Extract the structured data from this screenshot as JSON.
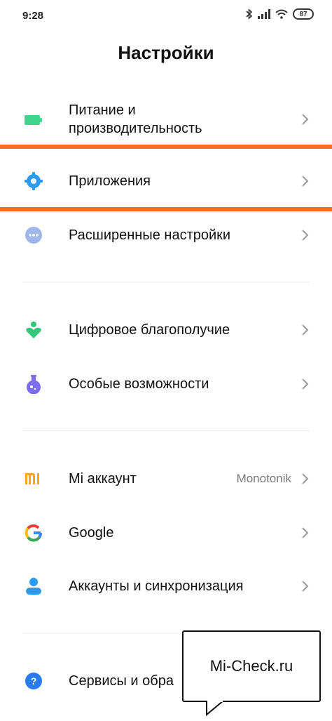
{
  "status_bar": {
    "time": "9:28",
    "battery": "87"
  },
  "header": {
    "title": "Настройки"
  },
  "groups": [
    {
      "items": [
        {
          "label_line1": "Питание и",
          "label_line2": "производительность",
          "icon": "battery-icon",
          "color": "#3dd68c"
        },
        {
          "label": "Приложения",
          "icon": "gear-icon",
          "color": "#2b9af3"
        },
        {
          "label": "Расширенные настройки",
          "icon": "more-dots-icon",
          "color": "#9fb6e8"
        }
      ]
    },
    {
      "items": [
        {
          "label": "Цифровое благополучие",
          "icon": "wellbeing-icon",
          "color": "#34c77b"
        },
        {
          "label": "Особые возможности",
          "icon": "flask-icon",
          "color": "#7d6cf0"
        }
      ]
    },
    {
      "items": [
        {
          "label": "Mi аккаунт",
          "value": "Monotonik",
          "icon": "mi-logo-icon",
          "color": "#f5a623"
        },
        {
          "label": "Google",
          "icon": "google-icon"
        },
        {
          "label": "Аккаунты и синхронизация",
          "icon": "person-icon",
          "color": "#2b9af3"
        }
      ]
    },
    {
      "items": [
        {
          "label": "Сервисы и обра",
          "icon": "help-icon",
          "color": "#2b7bf3"
        }
      ]
    }
  ],
  "highlight_color": "#f46b2a",
  "watermark": {
    "text": "Mi-Check.ru"
  }
}
